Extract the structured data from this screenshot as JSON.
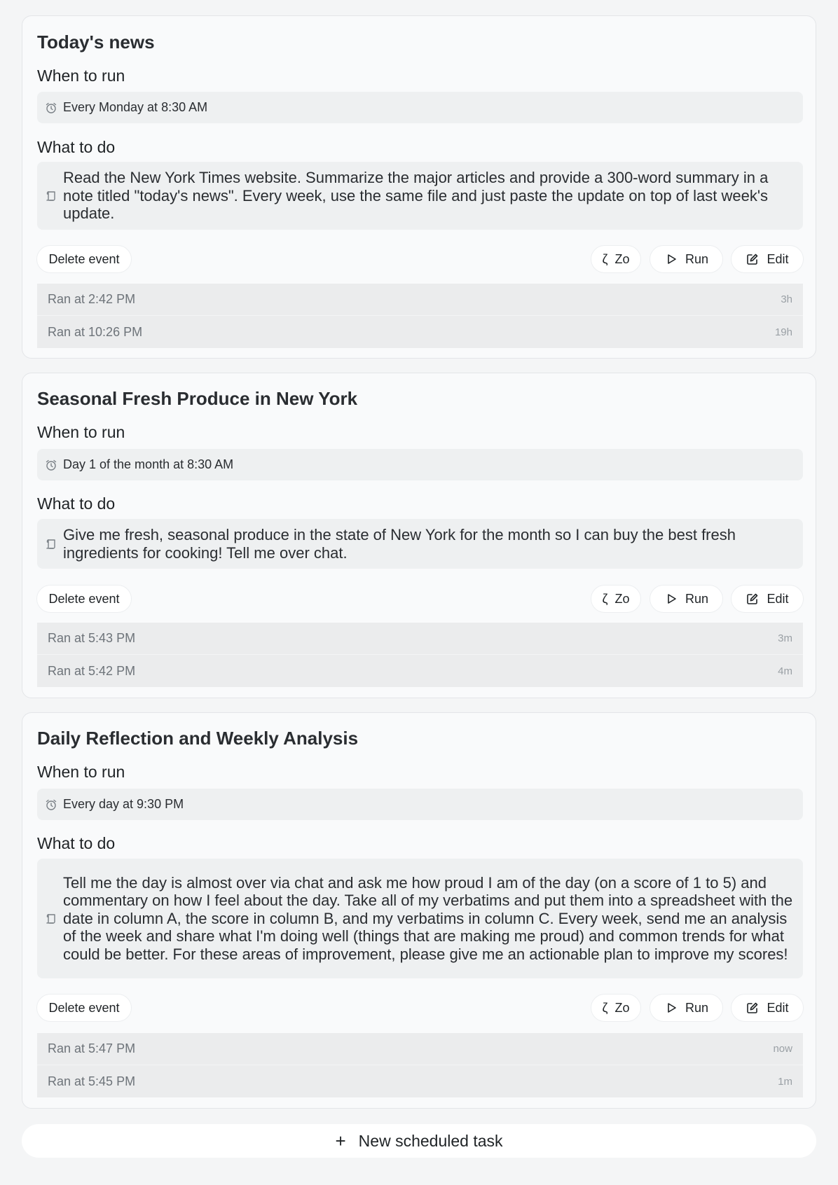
{
  "tasks": [
    {
      "title": "Today's news",
      "when_label": "When to run",
      "schedule": "Every Monday at 8:30 AM",
      "what_label": "What to do",
      "instructions": "Read the New York Times website. Summarize the major articles and provide a 300-word summary in a note titled \"today's news\". Every week, use the same file and just paste the update on top of last week's update.",
      "delete_label": "Delete event",
      "zo_label": "Zo",
      "run_label": "Run",
      "edit_label": "Edit",
      "runs": [
        {
          "text": "Ran at 2:42 PM",
          "ago": "3h"
        },
        {
          "text": "Ran at 10:26 PM",
          "ago": "19h"
        }
      ]
    },
    {
      "title": "Seasonal Fresh Produce in New York",
      "when_label": "When to run",
      "schedule": "Day 1 of the month at 8:30 AM",
      "what_label": "What to do",
      "instructions": "Give me fresh, seasonal produce in the state of New York for the month so I can buy the best fresh ingredients for cooking! Tell me over chat.",
      "delete_label": "Delete event",
      "zo_label": "Zo",
      "run_label": "Run",
      "edit_label": "Edit",
      "runs": [
        {
          "text": "Ran at 5:43 PM",
          "ago": "3m"
        },
        {
          "text": "Ran at 5:42 PM",
          "ago": "4m"
        }
      ]
    },
    {
      "title": "Daily Reflection and Weekly Analysis",
      "when_label": "When to run",
      "schedule": "Every day at 9:30 PM",
      "what_label": "What to do",
      "instructions": "Tell me the day is almost over via chat and ask me how proud I am of the day (on a score of 1 to 5) and commentary on how I feel about the day. Take all of my verbatims and put them into a spreadsheet with the date in column A, the score in column B, and my verbatims in column C. Every week, send me an analysis of the week and share what I'm doing well (things that are making me proud) and common trends for what could be better. For these areas of improvement, please give me an actionable plan to improve my scores!",
      "delete_label": "Delete event",
      "zo_label": "Zo",
      "run_label": "Run",
      "edit_label": "Edit",
      "runs": [
        {
          "text": "Ran at 5:47 PM",
          "ago": "now"
        },
        {
          "text": "Ran at 5:45 PM",
          "ago": "1m"
        }
      ]
    }
  ],
  "new_task_label": "New scheduled task",
  "new_task_icon": "plus-icon",
  "icons": {
    "schedule": "alarm-clock-icon",
    "instructions": "scroll-icon",
    "zo": "zeta-icon",
    "run": "play-icon",
    "edit": "edit-square-icon"
  }
}
